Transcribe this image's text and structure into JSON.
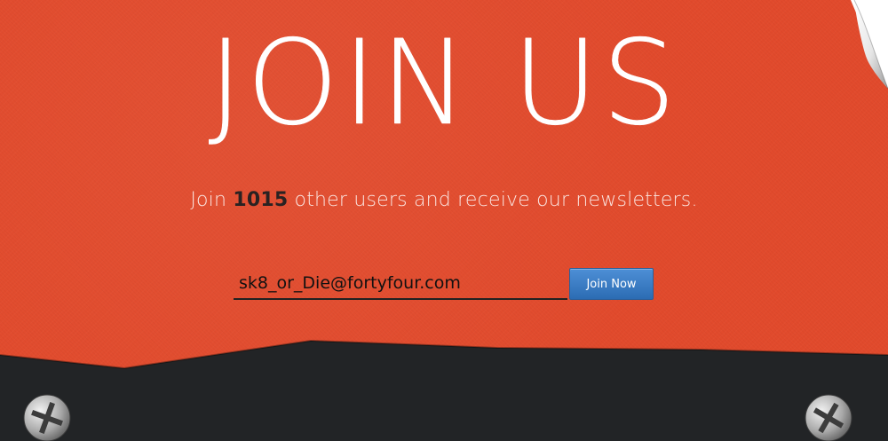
{
  "hero": {
    "title": "JOIN US"
  },
  "subtitle": {
    "prefix": "Join ",
    "count": "1015",
    "suffix": " other users and receive our newsletters."
  },
  "form": {
    "email_value": "sk8_or_Die@fortyfour.com",
    "button_label": "Join Now"
  },
  "colors": {
    "background": "#e14a2c",
    "ground": "#222426",
    "button": "#3a7cc4",
    "count_text": "#2a2222"
  },
  "icons": {
    "corner": "page-curl-icon",
    "screws": [
      "screw-icon",
      "screw-icon"
    ]
  }
}
